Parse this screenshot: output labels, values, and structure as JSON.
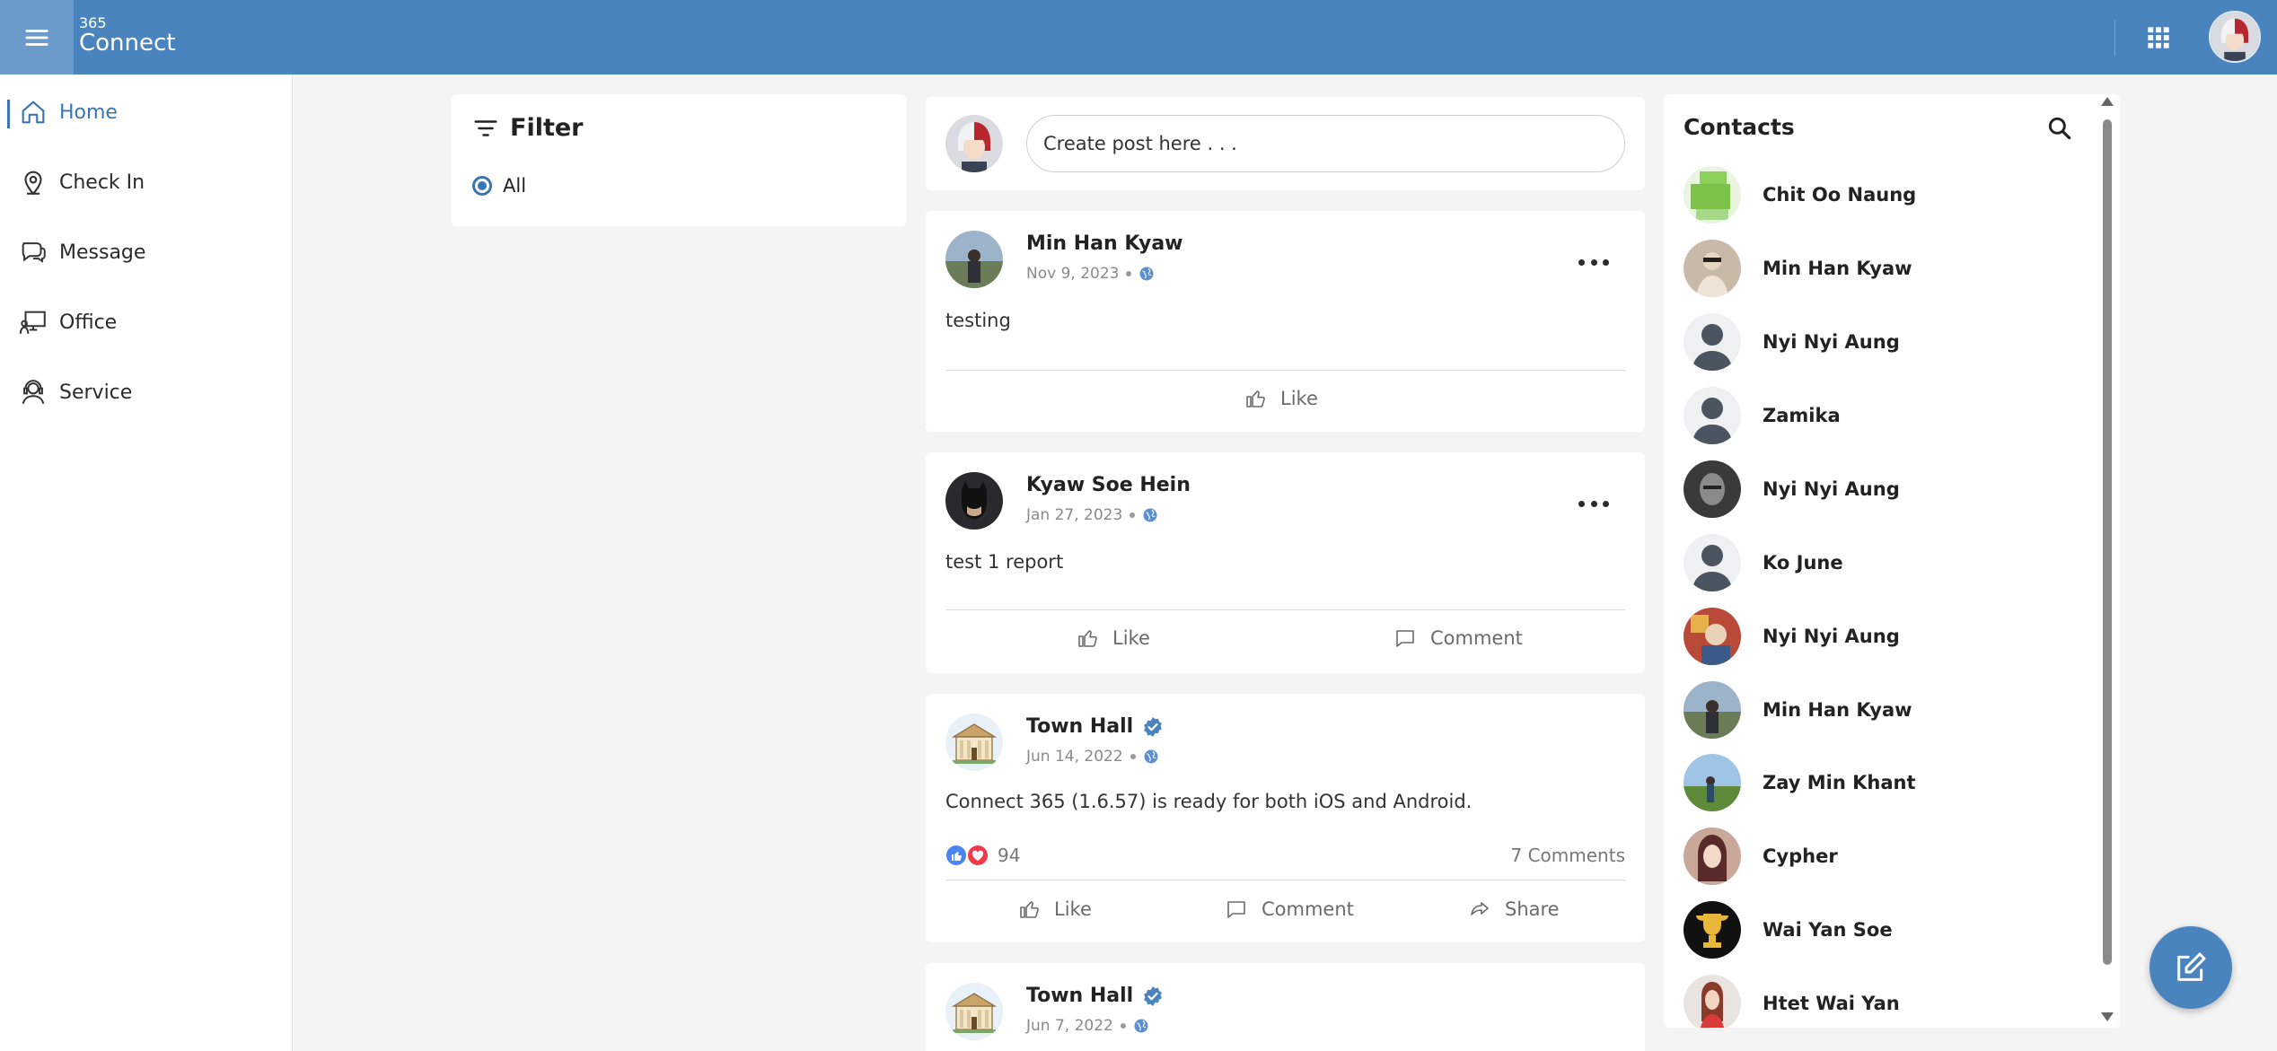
{
  "app": {
    "brand_small": "365",
    "brand_big": "Connect"
  },
  "colors": {
    "primary": "#4a84bf",
    "accent": "#3a76b3",
    "background": "#f4f4f4"
  },
  "sidebar": {
    "items": [
      {
        "label": "Home",
        "icon": "home-icon",
        "active": true
      },
      {
        "label": "Check In",
        "icon": "location-pin-icon",
        "active": false
      },
      {
        "label": "Message",
        "icon": "chat-bubbles-icon",
        "active": false
      },
      {
        "label": "Office",
        "icon": "office-icon",
        "active": false
      },
      {
        "label": "Service",
        "icon": "service-agent-icon",
        "active": false
      }
    ]
  },
  "filter": {
    "title": "Filter",
    "options": [
      {
        "label": "All",
        "selected": true
      }
    ]
  },
  "composer": {
    "placeholder": "Create post here . . ."
  },
  "posts": [
    {
      "author": "Min Han Kyaw",
      "date": "Nov 9, 2023",
      "text": "testing",
      "verified": false,
      "actions": [
        "Like"
      ]
    },
    {
      "author": "Kyaw Soe Hein",
      "date": "Jan 27, 2023",
      "text": "test 1 report",
      "verified": false,
      "actions": [
        "Like",
        "Comment"
      ]
    },
    {
      "author": "Town Hall",
      "date": "Jun 14, 2022",
      "text": "Connect 365 (1.6.57) is ready for both iOS and Android.",
      "verified": true,
      "reaction_count": "94",
      "comments": "7 Comments",
      "actions": [
        "Like",
        "Comment",
        "Share"
      ]
    },
    {
      "author": "Town Hall",
      "date": "Jun 7, 2022",
      "verified": true
    }
  ],
  "contacts": {
    "title": "Contacts",
    "items": [
      {
        "name": "Chit Oo Naung"
      },
      {
        "name": "Min Han Kyaw"
      },
      {
        "name": "Nyi Nyi Aung"
      },
      {
        "name": "Zamika"
      },
      {
        "name": "Nyi Nyi Aung"
      },
      {
        "name": "Ko June"
      },
      {
        "name": "Nyi Nyi Aung"
      },
      {
        "name": "Min Han Kyaw"
      },
      {
        "name": "Zay Min Khant"
      },
      {
        "name": "Cypher"
      },
      {
        "name": "Wai Yan Soe"
      },
      {
        "name": "Htet Wai Yan"
      }
    ]
  }
}
